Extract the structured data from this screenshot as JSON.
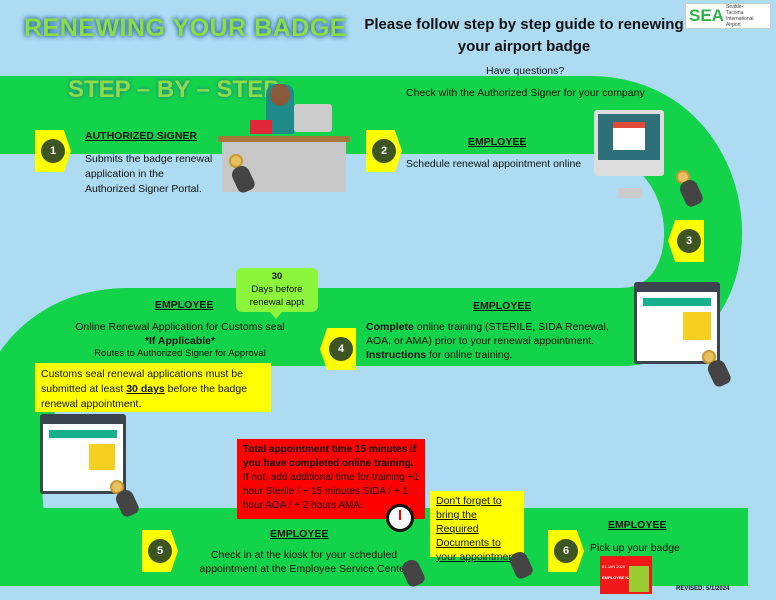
{
  "title": "RENEWING YOUR BADGE",
  "subtitle": "STEP – BY – STEP",
  "heading": "Please follow step by step guide to renewing your airport badge",
  "logo": {
    "mark": "SEA",
    "name": "Seattle-Tacoma International Airport"
  },
  "questions": {
    "line1": "Have questions?",
    "line2": "Check with the Authorized Signer for your company"
  },
  "steps": [
    {
      "num": "1",
      "role": "AUTHORIZED SIGNER",
      "text": "Submits the badge renewal application in the Authorized Signer Portal."
    },
    {
      "num": "2",
      "role": "EMPLOYEE",
      "text": "Schedule renewal appointment online"
    },
    {
      "num": "3"
    },
    {
      "num": "4",
      "role": "EMPLOYEE",
      "bold1": "Complete",
      "text1": " online training (STERILE, SIDA Renewal, AOA, or AMA) prior to your renewal appointment.  ",
      "bold2": "Instructions",
      "text2": " for online training."
    },
    {
      "num": "5",
      "role": "EMPLOYEE",
      "text": "Check in at the kiosk for your scheduled appointment at the Employee Service Center"
    },
    {
      "num": "6",
      "role": "EMPLOYEE",
      "text": "Pick up your badge"
    }
  ],
  "customs": {
    "role": "EMPLOYEE",
    "line1": "Online Renewal Application for Customs seal",
    "line2": "*If Applicable*",
    "line3": "Routes to Authorized Signer for Approval"
  },
  "bubble": {
    "num": "30",
    "text": "Days before renewal appt"
  },
  "customs_note": {
    "pre": "Customs seal renewal applications must be submitted at least ",
    "bold": "30 days",
    "post": " before the badge renewal appointment."
  },
  "time_note": {
    "bold": "Total appointment time 15 minutes if you have completed online training.",
    "text": "If not, add additional time for training +1 hour Sterile / + 15 minutes SIDA / + 1 hour AOA / + 2 hours AMA."
  },
  "docs_note": "Don't forget to bring the Required Documents to your appointment",
  "badge": {
    "date": "01 JAN 2020",
    "name": "EMPLOYEE NAME"
  },
  "revised": "REVISED: 5/1/2024",
  "colors": {
    "path": "#12d34a",
    "background": "#addcf2",
    "callout": "#ffff00",
    "alert": "#ff0000",
    "step_circle": "#3d5523"
  }
}
